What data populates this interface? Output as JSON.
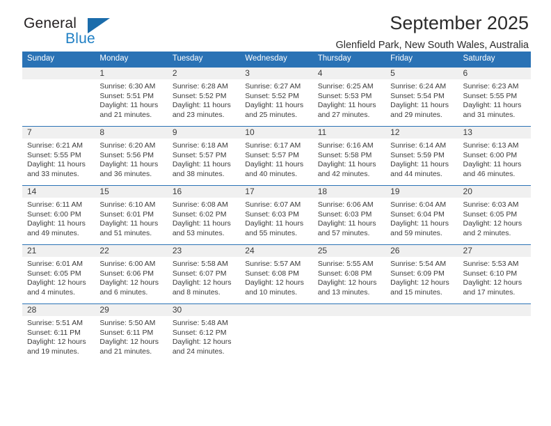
{
  "brand": {
    "name_part1": "General",
    "name_part2": "Blue",
    "triangle_icon": "triangle-icon",
    "accent_color": "#1b6cab"
  },
  "header": {
    "month_title": "September 2025",
    "location": "Glenfield Park, New South Wales, Australia"
  },
  "calendar": {
    "header_bg": "#2a72b5",
    "daynum_bg": "#f0f0f0",
    "weekday_headers": [
      "Sunday",
      "Monday",
      "Tuesday",
      "Wednesday",
      "Thursday",
      "Friday",
      "Saturday"
    ],
    "weeks": [
      [
        {
          "day": "",
          "lines": []
        },
        {
          "day": "1",
          "lines": [
            "Sunrise: 6:30 AM",
            "Sunset: 5:51 PM",
            "Daylight: 11 hours",
            "and 21 minutes."
          ]
        },
        {
          "day": "2",
          "lines": [
            "Sunrise: 6:28 AM",
            "Sunset: 5:52 PM",
            "Daylight: 11 hours",
            "and 23 minutes."
          ]
        },
        {
          "day": "3",
          "lines": [
            "Sunrise: 6:27 AM",
            "Sunset: 5:52 PM",
            "Daylight: 11 hours",
            "and 25 minutes."
          ]
        },
        {
          "day": "4",
          "lines": [
            "Sunrise: 6:25 AM",
            "Sunset: 5:53 PM",
            "Daylight: 11 hours",
            "and 27 minutes."
          ]
        },
        {
          "day": "5",
          "lines": [
            "Sunrise: 6:24 AM",
            "Sunset: 5:54 PM",
            "Daylight: 11 hours",
            "and 29 minutes."
          ]
        },
        {
          "day": "6",
          "lines": [
            "Sunrise: 6:23 AM",
            "Sunset: 5:55 PM",
            "Daylight: 11 hours",
            "and 31 minutes."
          ]
        }
      ],
      [
        {
          "day": "7",
          "lines": [
            "Sunrise: 6:21 AM",
            "Sunset: 5:55 PM",
            "Daylight: 11 hours",
            "and 33 minutes."
          ]
        },
        {
          "day": "8",
          "lines": [
            "Sunrise: 6:20 AM",
            "Sunset: 5:56 PM",
            "Daylight: 11 hours",
            "and 36 minutes."
          ]
        },
        {
          "day": "9",
          "lines": [
            "Sunrise: 6:18 AM",
            "Sunset: 5:57 PM",
            "Daylight: 11 hours",
            "and 38 minutes."
          ]
        },
        {
          "day": "10",
          "lines": [
            "Sunrise: 6:17 AM",
            "Sunset: 5:57 PM",
            "Daylight: 11 hours",
            "and 40 minutes."
          ]
        },
        {
          "day": "11",
          "lines": [
            "Sunrise: 6:16 AM",
            "Sunset: 5:58 PM",
            "Daylight: 11 hours",
            "and 42 minutes."
          ]
        },
        {
          "day": "12",
          "lines": [
            "Sunrise: 6:14 AM",
            "Sunset: 5:59 PM",
            "Daylight: 11 hours",
            "and 44 minutes."
          ]
        },
        {
          "day": "13",
          "lines": [
            "Sunrise: 6:13 AM",
            "Sunset: 6:00 PM",
            "Daylight: 11 hours",
            "and 46 minutes."
          ]
        }
      ],
      [
        {
          "day": "14",
          "lines": [
            "Sunrise: 6:11 AM",
            "Sunset: 6:00 PM",
            "Daylight: 11 hours",
            "and 49 minutes."
          ]
        },
        {
          "day": "15",
          "lines": [
            "Sunrise: 6:10 AM",
            "Sunset: 6:01 PM",
            "Daylight: 11 hours",
            "and 51 minutes."
          ]
        },
        {
          "day": "16",
          "lines": [
            "Sunrise: 6:08 AM",
            "Sunset: 6:02 PM",
            "Daylight: 11 hours",
            "and 53 minutes."
          ]
        },
        {
          "day": "17",
          "lines": [
            "Sunrise: 6:07 AM",
            "Sunset: 6:03 PM",
            "Daylight: 11 hours",
            "and 55 minutes."
          ]
        },
        {
          "day": "18",
          "lines": [
            "Sunrise: 6:06 AM",
            "Sunset: 6:03 PM",
            "Daylight: 11 hours",
            "and 57 minutes."
          ]
        },
        {
          "day": "19",
          "lines": [
            "Sunrise: 6:04 AM",
            "Sunset: 6:04 PM",
            "Daylight: 11 hours",
            "and 59 minutes."
          ]
        },
        {
          "day": "20",
          "lines": [
            "Sunrise: 6:03 AM",
            "Sunset: 6:05 PM",
            "Daylight: 12 hours",
            "and 2 minutes."
          ]
        }
      ],
      [
        {
          "day": "21",
          "lines": [
            "Sunrise: 6:01 AM",
            "Sunset: 6:05 PM",
            "Daylight: 12 hours",
            "and 4 minutes."
          ]
        },
        {
          "day": "22",
          "lines": [
            "Sunrise: 6:00 AM",
            "Sunset: 6:06 PM",
            "Daylight: 12 hours",
            "and 6 minutes."
          ]
        },
        {
          "day": "23",
          "lines": [
            "Sunrise: 5:58 AM",
            "Sunset: 6:07 PM",
            "Daylight: 12 hours",
            "and 8 minutes."
          ]
        },
        {
          "day": "24",
          "lines": [
            "Sunrise: 5:57 AM",
            "Sunset: 6:08 PM",
            "Daylight: 12 hours",
            "and 10 minutes."
          ]
        },
        {
          "day": "25",
          "lines": [
            "Sunrise: 5:55 AM",
            "Sunset: 6:08 PM",
            "Daylight: 12 hours",
            "and 13 minutes."
          ]
        },
        {
          "day": "26",
          "lines": [
            "Sunrise: 5:54 AM",
            "Sunset: 6:09 PM",
            "Daylight: 12 hours",
            "and 15 minutes."
          ]
        },
        {
          "day": "27",
          "lines": [
            "Sunrise: 5:53 AM",
            "Sunset: 6:10 PM",
            "Daylight: 12 hours",
            "and 17 minutes."
          ]
        }
      ],
      [
        {
          "day": "28",
          "lines": [
            "Sunrise: 5:51 AM",
            "Sunset: 6:11 PM",
            "Daylight: 12 hours",
            "and 19 minutes."
          ]
        },
        {
          "day": "29",
          "lines": [
            "Sunrise: 5:50 AM",
            "Sunset: 6:11 PM",
            "Daylight: 12 hours",
            "and 21 minutes."
          ]
        },
        {
          "day": "30",
          "lines": [
            "Sunrise: 5:48 AM",
            "Sunset: 6:12 PM",
            "Daylight: 12 hours",
            "and 24 minutes."
          ]
        },
        {
          "day": "",
          "lines": []
        },
        {
          "day": "",
          "lines": []
        },
        {
          "day": "",
          "lines": []
        },
        {
          "day": "",
          "lines": []
        }
      ]
    ]
  }
}
